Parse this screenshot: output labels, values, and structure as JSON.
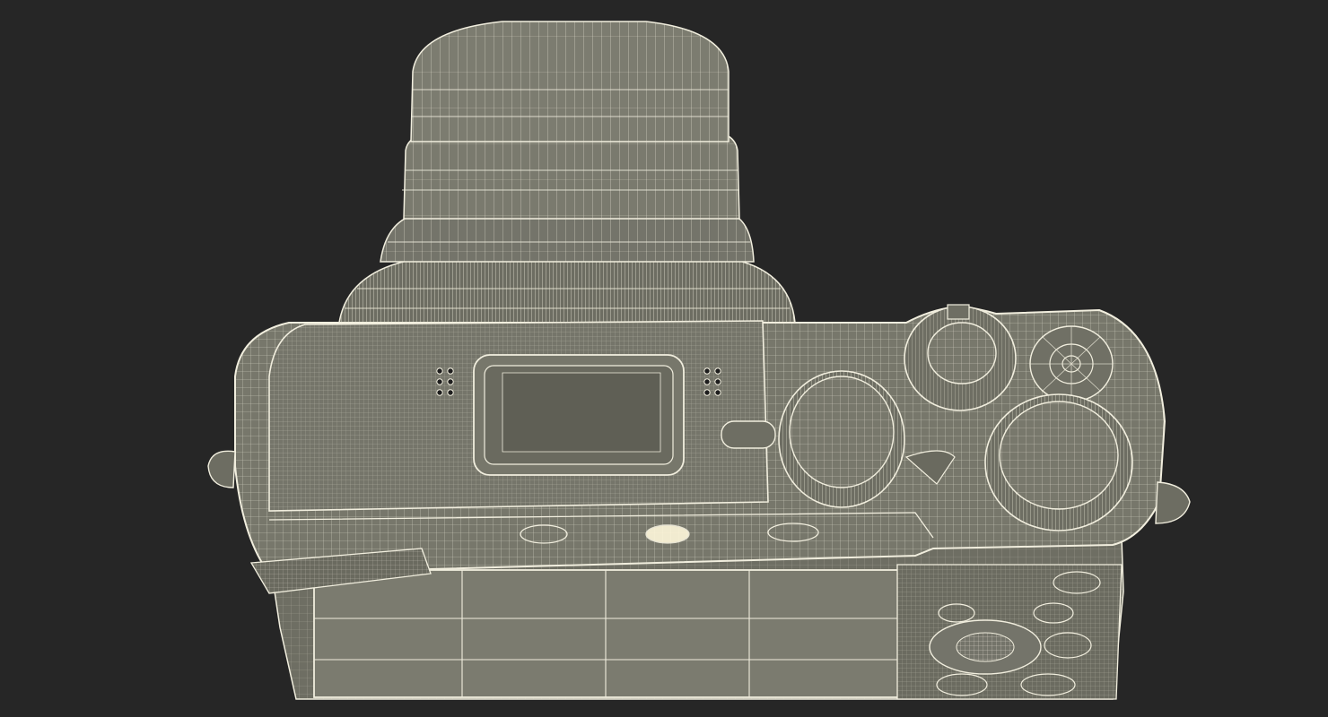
{
  "scene": {
    "subject": "camera-wireframe-render",
    "view": "top",
    "colors": {
      "background": "#262626",
      "surface": "#76766a",
      "surface_dark": "#626257",
      "screen": "#7b7b6f",
      "wire": "#f1eede",
      "wire_faint": "#c9c6b6",
      "highlight": "#fff8dc"
    }
  }
}
